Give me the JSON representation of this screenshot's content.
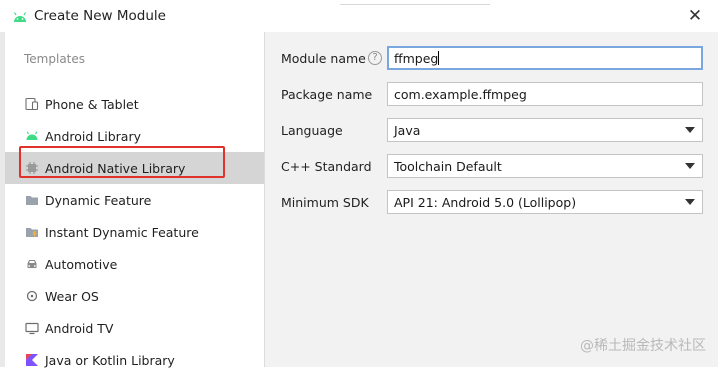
{
  "dialog": {
    "title": "Create New Module",
    "close_glyph": "✕"
  },
  "sidebar": {
    "section_label": "Templates",
    "items": [
      {
        "label": "Phone & Tablet",
        "icon": "phone-tablet-icon"
      },
      {
        "label": "Android Library",
        "icon": "android-icon"
      },
      {
        "label": "Android Native Library",
        "icon": "native-chip-icon",
        "selected": true
      },
      {
        "label": "Dynamic Feature",
        "icon": "folder-icon"
      },
      {
        "label": "Instant Dynamic Feature",
        "icon": "folder-instant-icon"
      },
      {
        "label": "Automotive",
        "icon": "car-icon"
      },
      {
        "label": "Wear OS",
        "icon": "watch-icon"
      },
      {
        "label": "Android TV",
        "icon": "tv-icon"
      },
      {
        "label": "Java or Kotlin Library",
        "icon": "kotlin-icon"
      }
    ]
  },
  "form": {
    "module_name": {
      "label": "Module name",
      "help": "?",
      "value": "ffmpeg"
    },
    "package_name": {
      "label": "Package name",
      "value": "com.example.ffmpeg"
    },
    "language": {
      "label": "Language",
      "value": "Java"
    },
    "cpp_standard": {
      "label": "C++ Standard",
      "value": "Toolchain Default"
    },
    "minimum_sdk": {
      "label": "Minimum SDK",
      "value": "API 21: Android 5.0 (Lollipop)"
    }
  },
  "watermark": "@稀土掘金技术社区",
  "colors": {
    "selected_bg": "#d5d5d5",
    "highlight_border": "#e0312b",
    "focus_border": "#7aa7e0",
    "android_green": "#3ddc84"
  }
}
